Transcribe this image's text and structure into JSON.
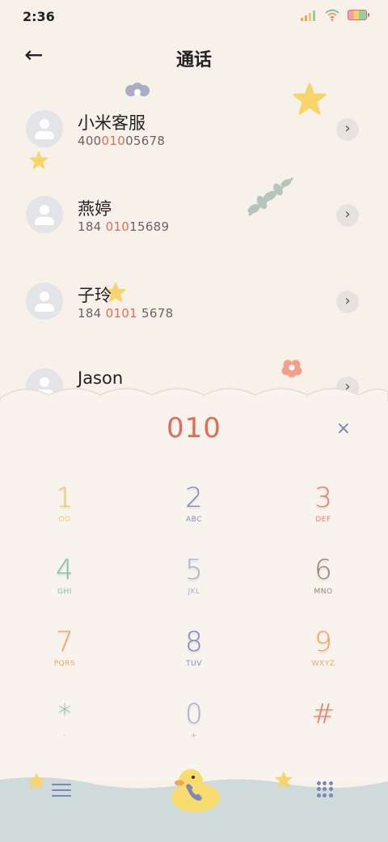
{
  "status": {
    "time": "2:36"
  },
  "header": {
    "title": "通话"
  },
  "contacts": [
    {
      "name": "小米客服",
      "num_pre": "400",
      "num_hl": "010",
      "num_post": "05678"
    },
    {
      "name": "燕婷",
      "num_pre": "184 ",
      "num_hl": "010",
      "num_post": "15689"
    },
    {
      "name": "子玲",
      "num_pre": "184 ",
      "num_hl": "0101",
      "num_post": " 5678"
    },
    {
      "name": "Jason",
      "num_pre": "",
      "num_hl": "",
      "num_post": ""
    }
  ],
  "dialer": {
    "input": "010",
    "keys": [
      {
        "digit": "1",
        "letters": "OO",
        "color": "#f0c96a"
      },
      {
        "digit": "2",
        "letters": "ABC",
        "color": "#7e8bc0"
      },
      {
        "digit": "3",
        "letters": "DEF",
        "color": "#e57c6c"
      },
      {
        "digit": "4",
        "letters": "GHI",
        "color": "#7fc0a6"
      },
      {
        "digit": "5",
        "letters": "JKL",
        "color": "#a7b2d6"
      },
      {
        "digit": "6",
        "letters": "MNO",
        "color": "#9c7d77"
      },
      {
        "digit": "7",
        "letters": "PQRS",
        "color": "#f0a55e"
      },
      {
        "digit": "8",
        "letters": "TUV",
        "color": "#7e8bc0"
      },
      {
        "digit": "9",
        "letters": "WXYZ",
        "color": "#f0a55e"
      },
      {
        "digit": "*",
        "letters": "·",
        "color": "#7fc0a6"
      },
      {
        "digit": "0",
        "letters": "+",
        "color": "#a7b2d6"
      },
      {
        "digit": "#",
        "letters": "",
        "color": "#e57c6c"
      }
    ]
  },
  "colors": {
    "accent": "#e06b57",
    "background": "#f7f1ea",
    "bottom_bar": "#cfdadb",
    "icon": "#7d88b8"
  },
  "icons": [
    "back-arrow-icon",
    "chevron-right-icon",
    "clear-icon",
    "menu-icon",
    "duck-call-icon",
    "dialpad-icon"
  ]
}
